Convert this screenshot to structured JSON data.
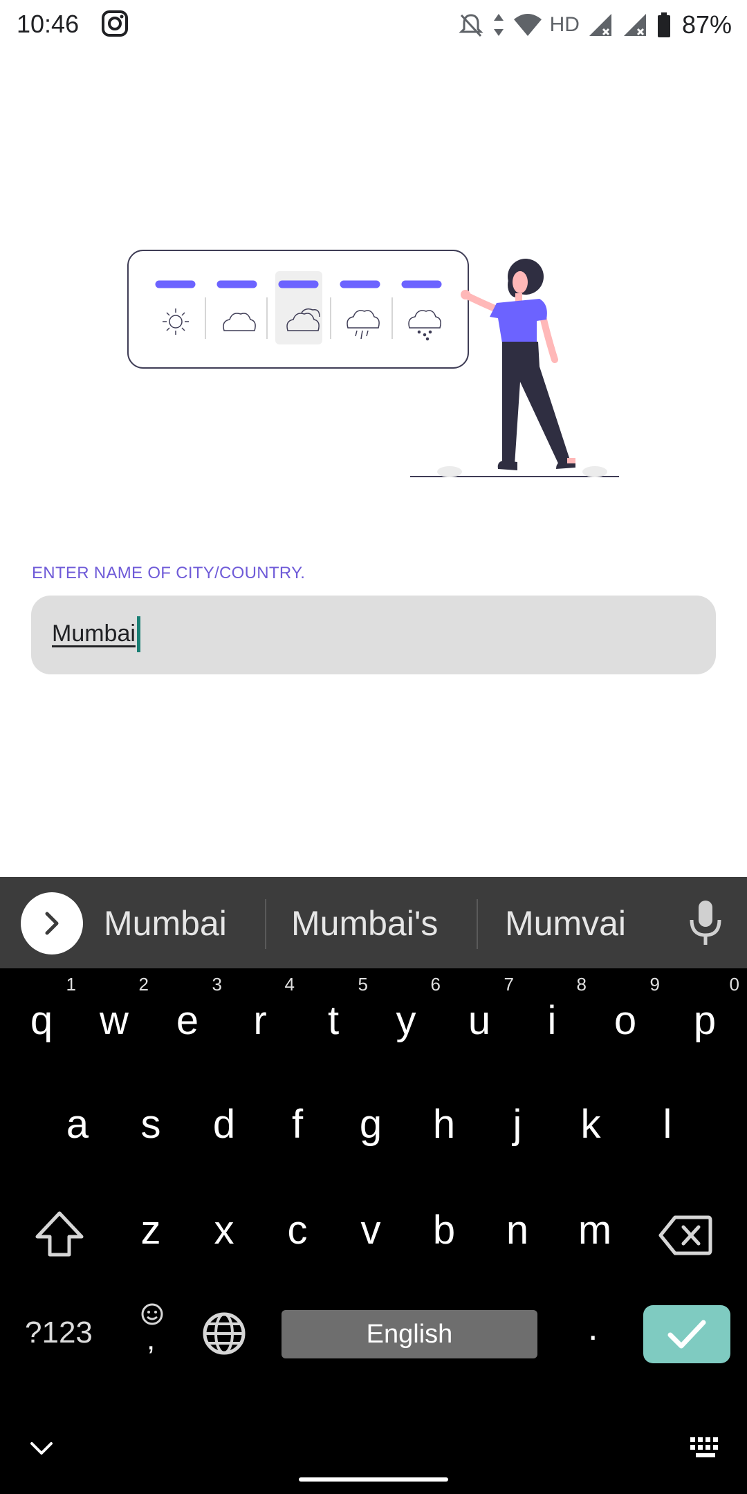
{
  "status_bar": {
    "time": "10:46",
    "network_label": "HD",
    "battery": "87%"
  },
  "form": {
    "label": "ENTER NAME OF CITY/COUNTRY.",
    "city_value": "Mumbai"
  },
  "keyboard": {
    "suggestions": [
      "Mumbai",
      "Mumbai's",
      "Mumvai"
    ],
    "row1": [
      {
        "key": "q",
        "num": "1"
      },
      {
        "key": "w",
        "num": "2"
      },
      {
        "key": "e",
        "num": "3"
      },
      {
        "key": "r",
        "num": "4"
      },
      {
        "key": "t",
        "num": "5"
      },
      {
        "key": "y",
        "num": "6"
      },
      {
        "key": "u",
        "num": "7"
      },
      {
        "key": "i",
        "num": "8"
      },
      {
        "key": "o",
        "num": "9"
      },
      {
        "key": "p",
        "num": "0"
      }
    ],
    "row2": [
      "a",
      "s",
      "d",
      "f",
      "g",
      "h",
      "j",
      "k",
      "l"
    ],
    "row3": [
      "z",
      "x",
      "c",
      "v",
      "b",
      "n",
      "m"
    ],
    "symbols_label": "?123",
    "emoji_comma": ",",
    "space_label": "English",
    "period": "."
  },
  "colors": {
    "accent_purple": "#6c63ff",
    "label_purple": "#6f5bd8",
    "input_bg": "#dedede",
    "caret": "#1a7f74",
    "enter_key": "#7fcbc1"
  },
  "icons": {
    "status": [
      "instagram-icon",
      "mute-icon",
      "data-arrows-icon",
      "wifi-icon",
      "signal-icon",
      "battery-icon"
    ],
    "weather": [
      "sun-icon",
      "cloud-icon",
      "cloudy-icon",
      "rain-icon",
      "snow-icon"
    ]
  }
}
